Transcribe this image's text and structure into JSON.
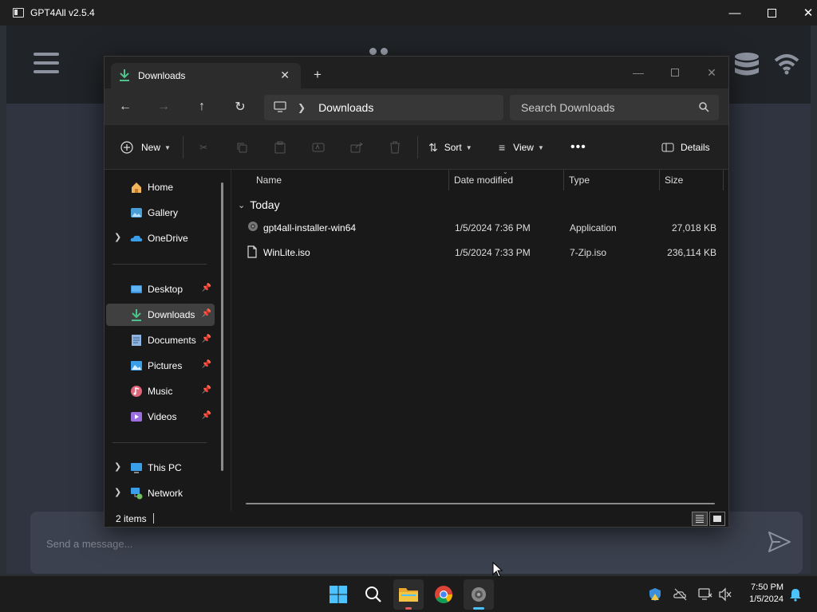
{
  "gpt4all": {
    "title": "GPT4All v2.5.4",
    "message_placeholder": "Send a message..."
  },
  "explorer": {
    "tab_label": "Downloads",
    "breadcrumb": "Downloads",
    "search_placeholder": "Search Downloads",
    "toolbar": {
      "new_label": "New",
      "sort_label": "Sort",
      "view_label": "View",
      "details_label": "Details"
    },
    "nav": {
      "home": "Home",
      "gallery": "Gallery",
      "onedrive": "OneDrive",
      "desktop": "Desktop",
      "downloads": "Downloads",
      "documents": "Documents",
      "pictures": "Pictures",
      "music": "Music",
      "videos": "Videos",
      "thispc": "This PC",
      "network": "Network"
    },
    "columns": {
      "name": "Name",
      "date": "Date modified",
      "type": "Type",
      "size": "Size"
    },
    "group_label": "Today",
    "files": [
      {
        "name": "gpt4all-installer-win64",
        "date": "1/5/2024 7:36 PM",
        "type": "Application",
        "size": "27,018 KB"
      },
      {
        "name": "WinLite.iso",
        "date": "1/5/2024 7:33 PM",
        "type": "7-Zip.iso",
        "size": "236,114 KB"
      }
    ],
    "status_count": "2 items"
  },
  "taskbar": {
    "time": "7:50 PM",
    "date": "1/5/2024"
  },
  "colors": {
    "accent": "#4cc2ff",
    "download_green": "#4cc38a",
    "folder_yellow": "#f4c542"
  }
}
